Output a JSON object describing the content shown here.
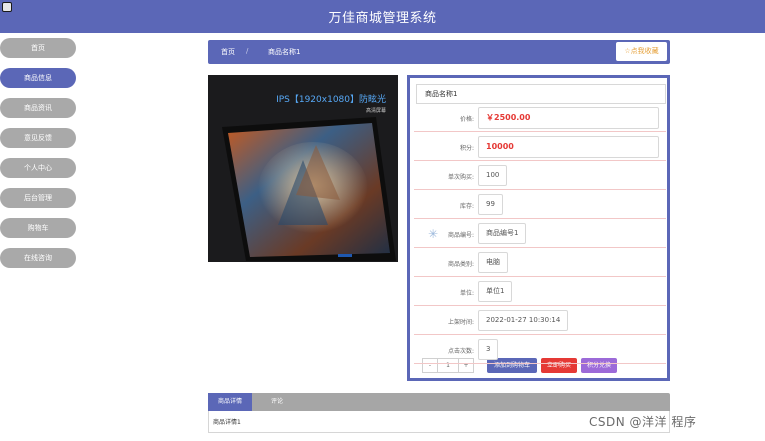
{
  "app": {
    "title": "万佳商城管理系统"
  },
  "sidebar": {
    "items": [
      {
        "label": "首页",
        "active": false
      },
      {
        "label": "商品信息",
        "active": true
      },
      {
        "label": "商品资讯",
        "active": false
      },
      {
        "label": "意见反馈",
        "active": false
      },
      {
        "label": "个人中心",
        "active": false
      },
      {
        "label": "后台管理",
        "active": false
      },
      {
        "label": "购物车",
        "active": false
      },
      {
        "label": "在线咨询",
        "active": false
      }
    ]
  },
  "breadcrumb": {
    "home": "首页",
    "separator": "/",
    "current": "商品名称1"
  },
  "favorite_button": {
    "icon": "star-outline-icon",
    "label": "☆点我收藏"
  },
  "product_image": {
    "tagline": "IPS【1920x1080】防眩光",
    "subline": "高清屏幕"
  },
  "product": {
    "name": "商品名称1",
    "fields": [
      {
        "label": "价格:",
        "value": "￥2500.00",
        "highlight": true
      },
      {
        "label": "积分:",
        "value": "10000",
        "highlight": true
      },
      {
        "label": "单次购买:",
        "value": "100",
        "highlight": false
      },
      {
        "label": "库存:",
        "value": "99",
        "highlight": false
      },
      {
        "label": "商品编号:",
        "value": "商品编号1",
        "highlight": false
      },
      {
        "label": "商品类别:",
        "value": "电脑",
        "highlight": false
      },
      {
        "label": "单位:",
        "value": "单位1",
        "highlight": false
      },
      {
        "label": "上架时间:",
        "value": "2022-01-27 10:30:14",
        "highlight": false
      },
      {
        "label": "点击次数:",
        "value": "3",
        "highlight": false
      }
    ]
  },
  "quantity": {
    "minus": "-",
    "value": "1",
    "plus": "+"
  },
  "actions": {
    "add_to_cart": "添加到购物车",
    "buy_now": "立即购买",
    "points_exchange": "积分兑换"
  },
  "colors": {
    "primary": "#5b67b7",
    "cart": "#5b67b7",
    "buy": "#e53935",
    "exchange": "#9c6ad8",
    "price": "#e53935"
  },
  "tabs": [
    {
      "label": "商品详情",
      "active": true
    },
    {
      "label": "评论",
      "active": false
    }
  ],
  "tab_content": "商品详情1",
  "watermark": "CSDN @洋洋  程序"
}
